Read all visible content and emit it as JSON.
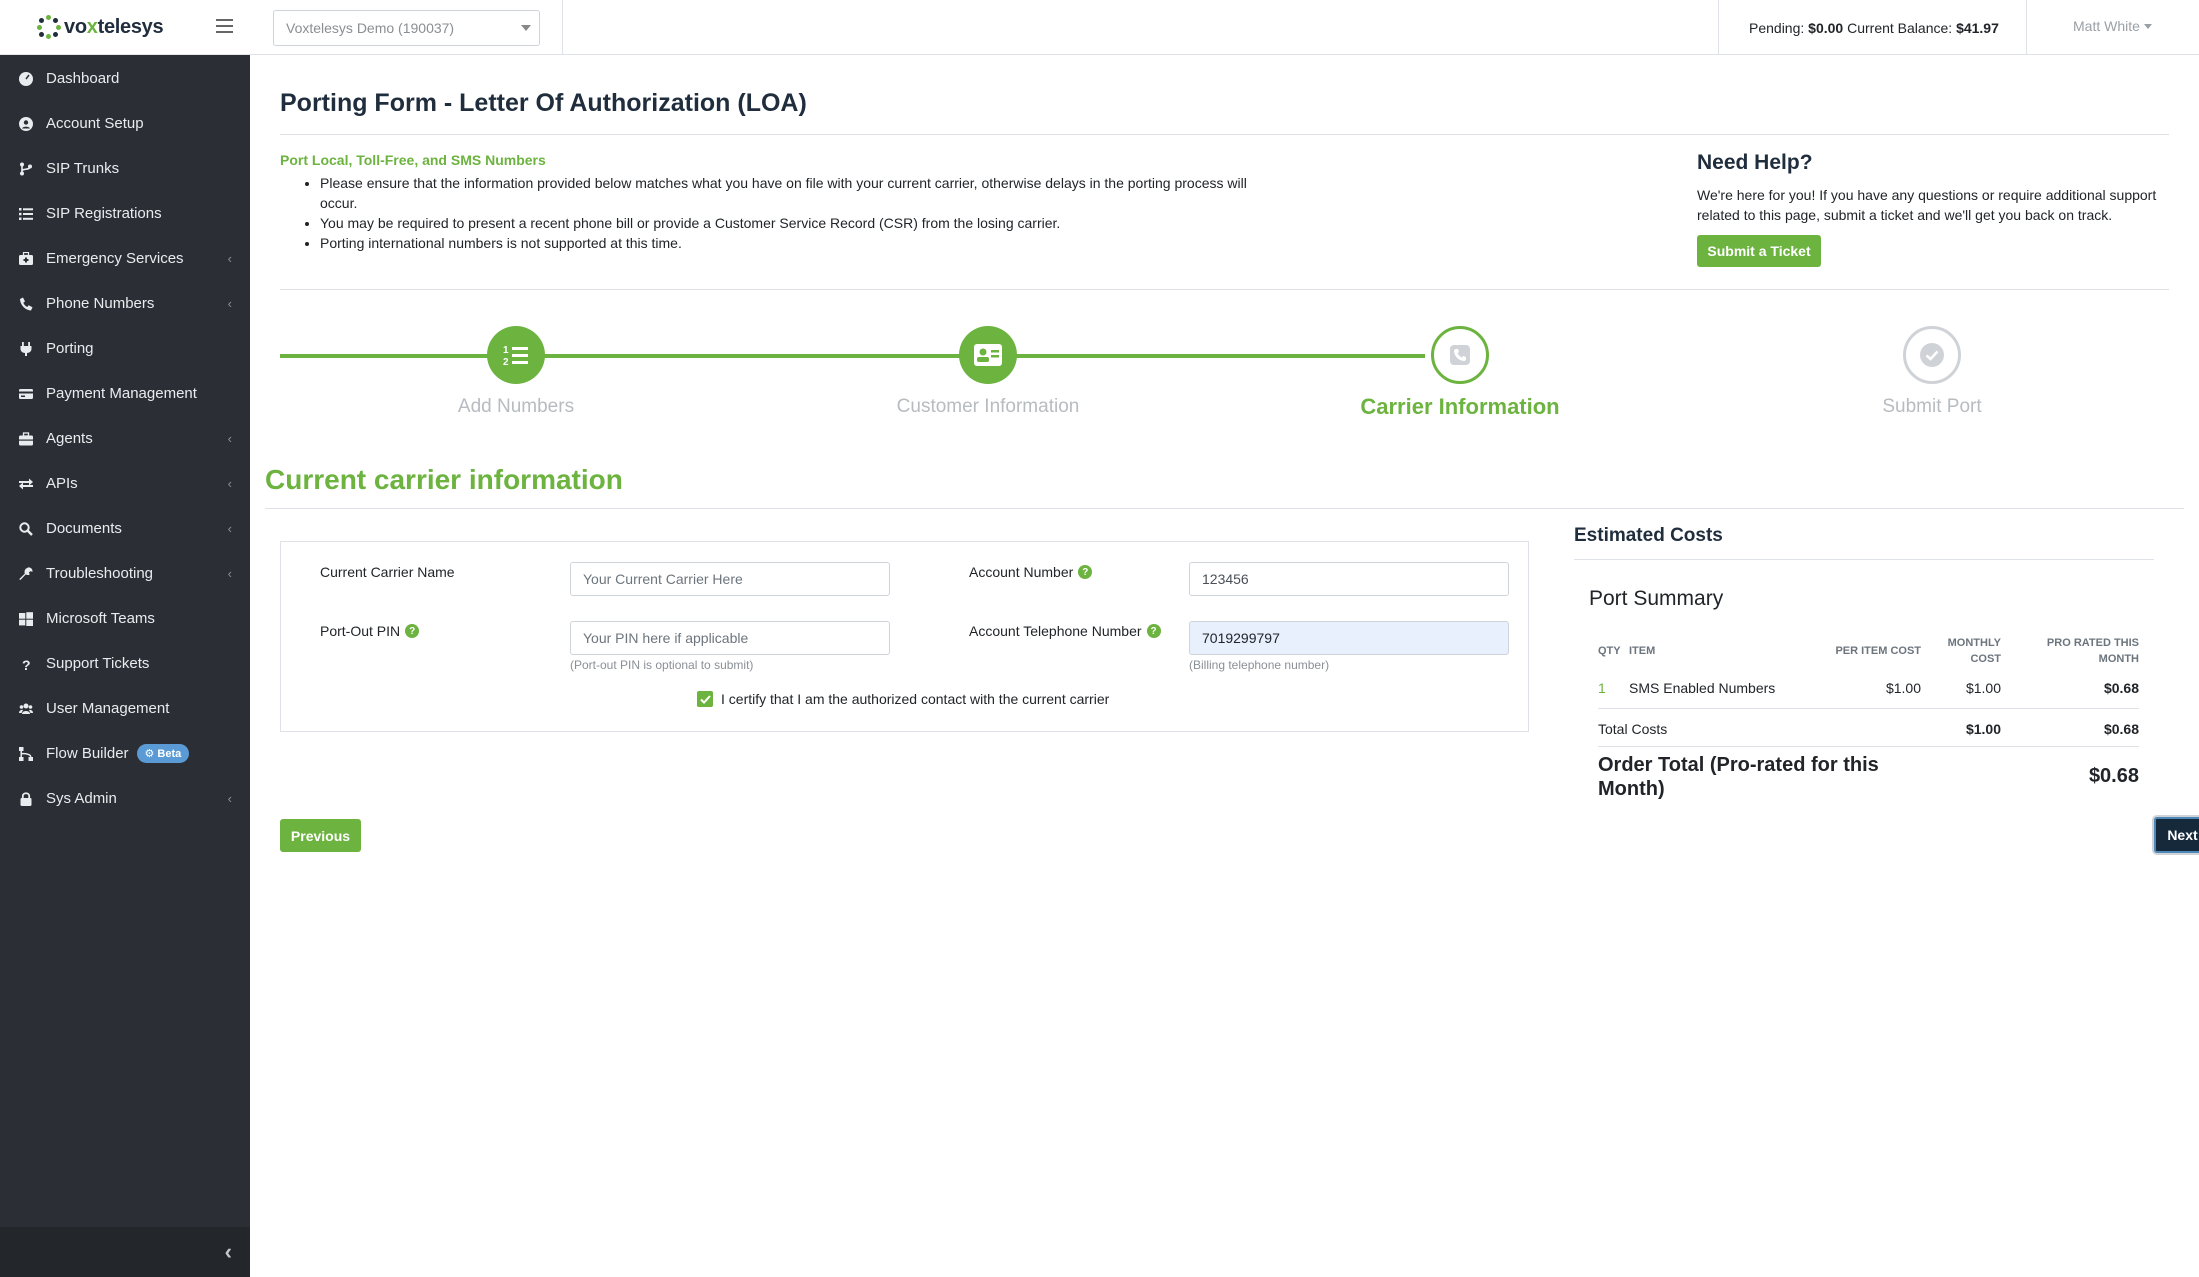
{
  "brand": {
    "name_prefix": "vo",
    "name_accent": "x",
    "name_suffix": "telesys"
  },
  "sidebar": {
    "items": [
      {
        "label": "Dashboard",
        "icon": "dashboard-icon",
        "submenu": false
      },
      {
        "label": "Account Setup",
        "icon": "user-circle-icon",
        "submenu": false
      },
      {
        "label": "SIP Trunks",
        "icon": "code-branch-icon",
        "submenu": false
      },
      {
        "label": "SIP Registrations",
        "icon": "list-icon",
        "submenu": false
      },
      {
        "label": "Emergency Services",
        "icon": "medkit-icon",
        "submenu": true
      },
      {
        "label": "Phone Numbers",
        "icon": "phone-icon",
        "submenu": true
      },
      {
        "label": "Porting",
        "icon": "plug-icon",
        "submenu": false
      },
      {
        "label": "Payment Management",
        "icon": "credit-card-icon",
        "submenu": false
      },
      {
        "label": "Agents",
        "icon": "briefcase-icon",
        "submenu": true
      },
      {
        "label": "APIs",
        "icon": "exchange-icon",
        "submenu": true
      },
      {
        "label": "Documents",
        "icon": "search-icon",
        "submenu": true
      },
      {
        "label": "Troubleshooting",
        "icon": "wrench-icon",
        "submenu": true
      },
      {
        "label": "Microsoft Teams",
        "icon": "windows-icon",
        "submenu": false
      },
      {
        "label": "Support Tickets",
        "icon": "question-icon",
        "submenu": false
      },
      {
        "label": "User Management",
        "icon": "users-icon",
        "submenu": false
      },
      {
        "label": "Flow Builder",
        "icon": "sitemap-icon",
        "submenu": false,
        "badge": "Beta"
      },
      {
        "label": "Sys Admin",
        "icon": "lock-icon",
        "submenu": true
      }
    ],
    "caret": "‹",
    "collapse": "‹"
  },
  "topbar": {
    "account_select": "Voxtelesys Demo (190037)",
    "pending_label": "Pending:",
    "pending_value": "$0.00",
    "balance_label": "Current Balance:",
    "balance_value": "$41.97",
    "user_name": "Matt White"
  },
  "page": {
    "title": "Porting Form - Letter Of Authorization (LOA)",
    "intro_subhead": "Port Local, Toll-Free, and SMS Numbers",
    "intro_bullets": [
      "Please ensure that the information provided below matches what you have on file with your current carrier, otherwise delays in the porting process will occur.",
      "You may be required to present a recent phone bill or provide a Customer Service Record (CSR) from the losing carrier.",
      "Porting international numbers is not supported at this time."
    ],
    "help_title": "Need Help?",
    "help_text": "We're here for you! If you have any questions or require additional support related to this page, submit a ticket and we'll get you back on track.",
    "help_button": "Submit a Ticket"
  },
  "stepper": {
    "steps": [
      {
        "label": "Add Numbers",
        "state": "done",
        "icon": "list-ol-icon"
      },
      {
        "label": "Customer Information",
        "state": "done",
        "icon": "address-card-icon"
      },
      {
        "label": "Carrier Information",
        "state": "active",
        "icon": "phone-square-icon"
      },
      {
        "label": "Submit Port",
        "state": "todo",
        "icon": "check-circle-icon"
      }
    ]
  },
  "form": {
    "section_title": "Current carrier information",
    "carrier_name_label": "Current Carrier Name",
    "carrier_name_placeholder": "Your Current Carrier Here",
    "carrier_name_value": "",
    "account_number_label": "Account Number",
    "account_number_value": "123456",
    "pin_label": "Port-Out PIN",
    "pin_placeholder": "Your PIN here if applicable",
    "pin_help": "(Port-out PIN is optional to submit)",
    "account_tel_label": "Account Telephone Number",
    "account_tel_value": "7019299797",
    "account_tel_help": "(Billing telephone number)",
    "certify_label": "I certify that I am the authorized contact with the current carrier",
    "certify_checked": true,
    "help_mark": "?"
  },
  "costs": {
    "title": "Estimated Costs",
    "summary_title": "Port Summary",
    "headers": {
      "qty": "QTY",
      "item": "ITEM",
      "per_item": "PER ITEM COST",
      "monthly_1": "MONTHLY",
      "monthly_2": "COST",
      "prorated_1": "PRO RATED THIS",
      "prorated_2": "MONTH"
    },
    "row": {
      "qty": "1",
      "item": "SMS Enabled Numbers",
      "per_item": "$1.00",
      "monthly": "$1.00",
      "prorated": "$0.68"
    },
    "total_label": "Total Costs",
    "total_monthly": "$1.00",
    "total_prorated": "$0.68",
    "order_total_label_1": "Order Total (Pro-rated for this",
    "order_total_label_2": "Month)",
    "order_total_value": "$0.68"
  },
  "buttons": {
    "previous": "Previous",
    "next": "Next"
  },
  "colors": {
    "accent": "#6cb33f",
    "sidebar": "#2b2f35",
    "next_button": "#15293b"
  }
}
